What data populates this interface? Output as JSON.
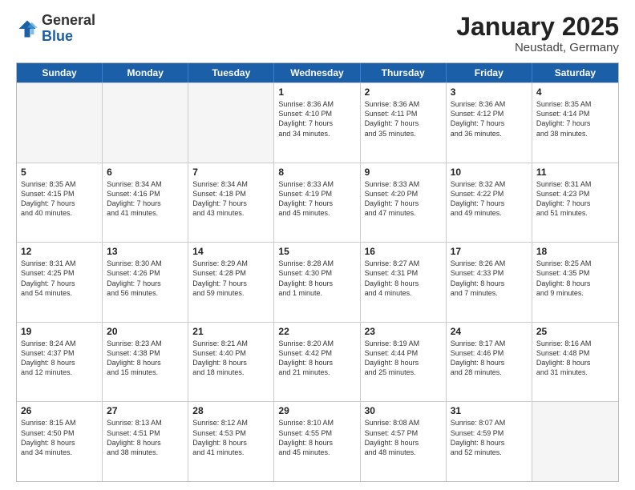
{
  "logo": {
    "general": "General",
    "blue": "Blue"
  },
  "title": "January 2025",
  "subtitle": "Neustadt, Germany",
  "days": [
    "Sunday",
    "Monday",
    "Tuesday",
    "Wednesday",
    "Thursday",
    "Friday",
    "Saturday"
  ],
  "weeks": [
    [
      {
        "day": "",
        "text": ""
      },
      {
        "day": "",
        "text": ""
      },
      {
        "day": "",
        "text": ""
      },
      {
        "day": "1",
        "text": "Sunrise: 8:36 AM\nSunset: 4:10 PM\nDaylight: 7 hours\nand 34 minutes."
      },
      {
        "day": "2",
        "text": "Sunrise: 8:36 AM\nSunset: 4:11 PM\nDaylight: 7 hours\nand 35 minutes."
      },
      {
        "day": "3",
        "text": "Sunrise: 8:36 AM\nSunset: 4:12 PM\nDaylight: 7 hours\nand 36 minutes."
      },
      {
        "day": "4",
        "text": "Sunrise: 8:35 AM\nSunset: 4:14 PM\nDaylight: 7 hours\nand 38 minutes."
      }
    ],
    [
      {
        "day": "5",
        "text": "Sunrise: 8:35 AM\nSunset: 4:15 PM\nDaylight: 7 hours\nand 40 minutes."
      },
      {
        "day": "6",
        "text": "Sunrise: 8:34 AM\nSunset: 4:16 PM\nDaylight: 7 hours\nand 41 minutes."
      },
      {
        "day": "7",
        "text": "Sunrise: 8:34 AM\nSunset: 4:18 PM\nDaylight: 7 hours\nand 43 minutes."
      },
      {
        "day": "8",
        "text": "Sunrise: 8:33 AM\nSunset: 4:19 PM\nDaylight: 7 hours\nand 45 minutes."
      },
      {
        "day": "9",
        "text": "Sunrise: 8:33 AM\nSunset: 4:20 PM\nDaylight: 7 hours\nand 47 minutes."
      },
      {
        "day": "10",
        "text": "Sunrise: 8:32 AM\nSunset: 4:22 PM\nDaylight: 7 hours\nand 49 minutes."
      },
      {
        "day": "11",
        "text": "Sunrise: 8:31 AM\nSunset: 4:23 PM\nDaylight: 7 hours\nand 51 minutes."
      }
    ],
    [
      {
        "day": "12",
        "text": "Sunrise: 8:31 AM\nSunset: 4:25 PM\nDaylight: 7 hours\nand 54 minutes."
      },
      {
        "day": "13",
        "text": "Sunrise: 8:30 AM\nSunset: 4:26 PM\nDaylight: 7 hours\nand 56 minutes."
      },
      {
        "day": "14",
        "text": "Sunrise: 8:29 AM\nSunset: 4:28 PM\nDaylight: 7 hours\nand 59 minutes."
      },
      {
        "day": "15",
        "text": "Sunrise: 8:28 AM\nSunset: 4:30 PM\nDaylight: 8 hours\nand 1 minute."
      },
      {
        "day": "16",
        "text": "Sunrise: 8:27 AM\nSunset: 4:31 PM\nDaylight: 8 hours\nand 4 minutes."
      },
      {
        "day": "17",
        "text": "Sunrise: 8:26 AM\nSunset: 4:33 PM\nDaylight: 8 hours\nand 7 minutes."
      },
      {
        "day": "18",
        "text": "Sunrise: 8:25 AM\nSunset: 4:35 PM\nDaylight: 8 hours\nand 9 minutes."
      }
    ],
    [
      {
        "day": "19",
        "text": "Sunrise: 8:24 AM\nSunset: 4:37 PM\nDaylight: 8 hours\nand 12 minutes."
      },
      {
        "day": "20",
        "text": "Sunrise: 8:23 AM\nSunset: 4:38 PM\nDaylight: 8 hours\nand 15 minutes."
      },
      {
        "day": "21",
        "text": "Sunrise: 8:21 AM\nSunset: 4:40 PM\nDaylight: 8 hours\nand 18 minutes."
      },
      {
        "day": "22",
        "text": "Sunrise: 8:20 AM\nSunset: 4:42 PM\nDaylight: 8 hours\nand 21 minutes."
      },
      {
        "day": "23",
        "text": "Sunrise: 8:19 AM\nSunset: 4:44 PM\nDaylight: 8 hours\nand 25 minutes."
      },
      {
        "day": "24",
        "text": "Sunrise: 8:17 AM\nSunset: 4:46 PM\nDaylight: 8 hours\nand 28 minutes."
      },
      {
        "day": "25",
        "text": "Sunrise: 8:16 AM\nSunset: 4:48 PM\nDaylight: 8 hours\nand 31 minutes."
      }
    ],
    [
      {
        "day": "26",
        "text": "Sunrise: 8:15 AM\nSunset: 4:50 PM\nDaylight: 8 hours\nand 34 minutes."
      },
      {
        "day": "27",
        "text": "Sunrise: 8:13 AM\nSunset: 4:51 PM\nDaylight: 8 hours\nand 38 minutes."
      },
      {
        "day": "28",
        "text": "Sunrise: 8:12 AM\nSunset: 4:53 PM\nDaylight: 8 hours\nand 41 minutes."
      },
      {
        "day": "29",
        "text": "Sunrise: 8:10 AM\nSunset: 4:55 PM\nDaylight: 8 hours\nand 45 minutes."
      },
      {
        "day": "30",
        "text": "Sunrise: 8:08 AM\nSunset: 4:57 PM\nDaylight: 8 hours\nand 48 minutes."
      },
      {
        "day": "31",
        "text": "Sunrise: 8:07 AM\nSunset: 4:59 PM\nDaylight: 8 hours\nand 52 minutes."
      },
      {
        "day": "",
        "text": ""
      }
    ]
  ]
}
